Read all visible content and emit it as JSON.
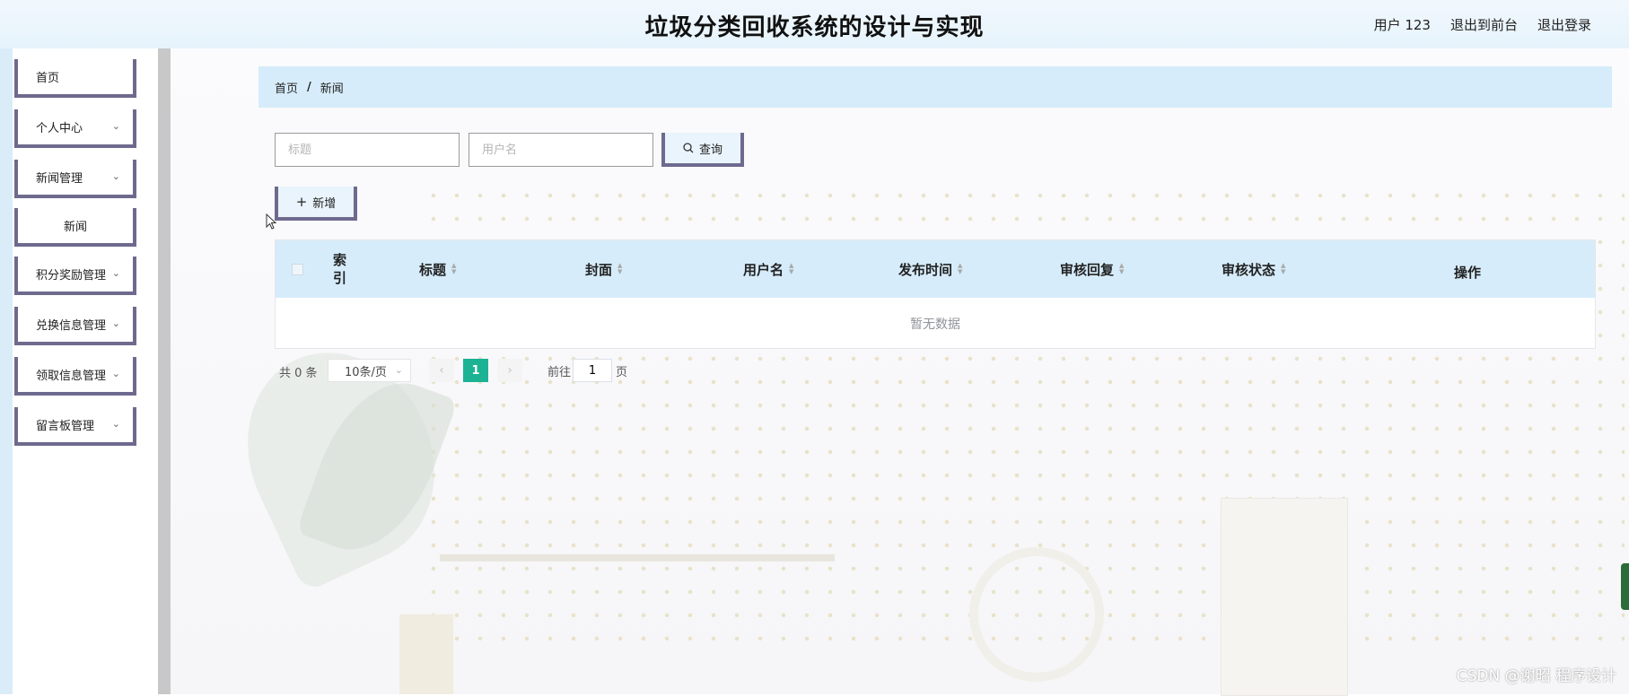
{
  "header": {
    "title": "垃圾分类回收系统的设计与实现",
    "user": "用户 123",
    "to_front": "退出到前台",
    "logout": "退出登录"
  },
  "sidebar": {
    "items": [
      {
        "label": "首页"
      },
      {
        "label": "个人中心"
      },
      {
        "label": "新闻管理"
      },
      {
        "label": "新闻"
      },
      {
        "label": "积分奖励管理"
      },
      {
        "label": "兑换信息管理"
      },
      {
        "label": "领取信息管理"
      },
      {
        "label": "留言板管理"
      }
    ]
  },
  "breadcrumb": {
    "home": "首页",
    "separator": "/",
    "current": "新闻"
  },
  "search": {
    "title_placeholder": "标题",
    "username_placeholder": "用户名",
    "query_label": "查询"
  },
  "actions": {
    "add_label": "新增"
  },
  "table": {
    "columns": [
      "索引",
      "标题",
      "封面",
      "用户名",
      "发布时间",
      "审核回复",
      "审核状态",
      "操作"
    ],
    "index_line1": "索",
    "index_line2": "引",
    "empty_text": "暂无数据"
  },
  "pagination": {
    "total": "共 0 条",
    "page_size": "10条/页",
    "current_page": "1",
    "goto_label": "前往",
    "goto_value": "1",
    "page_suffix": "页"
  },
  "watermark": "CSDN @谢昭  程序设计",
  "colors": {
    "accent": "#1bb394",
    "header_bg": "#d6ecfa",
    "button_border": "#6e6a8e"
  }
}
